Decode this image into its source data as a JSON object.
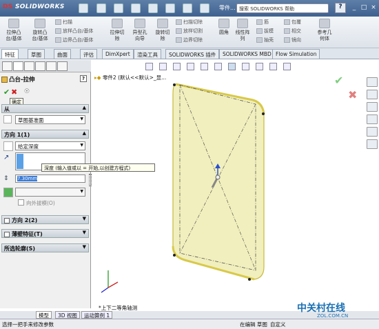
{
  "app": {
    "logo": "SOLIDWORKS",
    "doc_title": "零件...",
    "search_placeholder": "搜索 SOLIDWORKS 帮助",
    "help": "?"
  },
  "ribbon": {
    "buttons": [
      {
        "l1": "拉伸凸",
        "l2": "台/基体"
      },
      {
        "l1": "旋转凸",
        "l2": "台/基体"
      },
      {
        "small": [
          "扫描",
          "放样凸台/基体",
          "边界凸台/基体"
        ]
      },
      {
        "l1": "拉伸切",
        "l2": "除"
      },
      {
        "l1": "异型孔",
        "l2": "向导"
      },
      {
        "l1": "旋转切",
        "l2": "除"
      },
      {
        "small": [
          "扫描切除",
          "放样切割",
          "边界切除"
        ]
      },
      {
        "l1": "圆角",
        "l2": ""
      },
      {
        "l1": "线性阵",
        "l2": "列"
      },
      {
        "small": [
          "筋",
          "拔模",
          "抽壳"
        ]
      },
      {
        "small": [
          "包覆",
          "相交",
          "镜向"
        ]
      },
      {
        "l1": "参考几",
        "l2": "何体"
      }
    ]
  },
  "tabs": [
    "特征",
    "草图",
    "曲面",
    "评估",
    "DimXpert",
    "渲染工具",
    "SOLIDWORKS 插件",
    "SOLIDWORKS MBD",
    "Flow Simulation"
  ],
  "pm": {
    "title": "凸台-拉伸",
    "tooltip_ok": "确定",
    "from_label": "从",
    "from_value": "草图基准面",
    "dir1_label": "方向 1(1)",
    "dir1_type": "给定深度",
    "depth_value": "7.30mm",
    "draft_label": "向外拔模(O)",
    "dir2_label": "方向 2(2)",
    "thin_label": "薄壁特征(T)",
    "contours_label": "所选轮廓(S)"
  },
  "depth_tooltip": "深度 (输入值或以 = 开始,以创建方程式)",
  "tree": {
    "item": "零件2 (默认<<默认>_显..."
  },
  "view_label": "*上下二等角轴测",
  "bottom_tabs": [
    "模型",
    "3D 视图",
    "运动算例 1"
  ],
  "status": {
    "left": "选择一把手来修改参数",
    "mode": "在编辑 草图",
    "units": "自定义"
  },
  "watermark": {
    "cn": "中关村在线",
    "en": "ZOL.COM.CN"
  },
  "colors": {
    "title_bg": "#3f6190",
    "part": "#f1efbd",
    "edge": "#d8c94a",
    "accent": "#1a6fb3"
  }
}
